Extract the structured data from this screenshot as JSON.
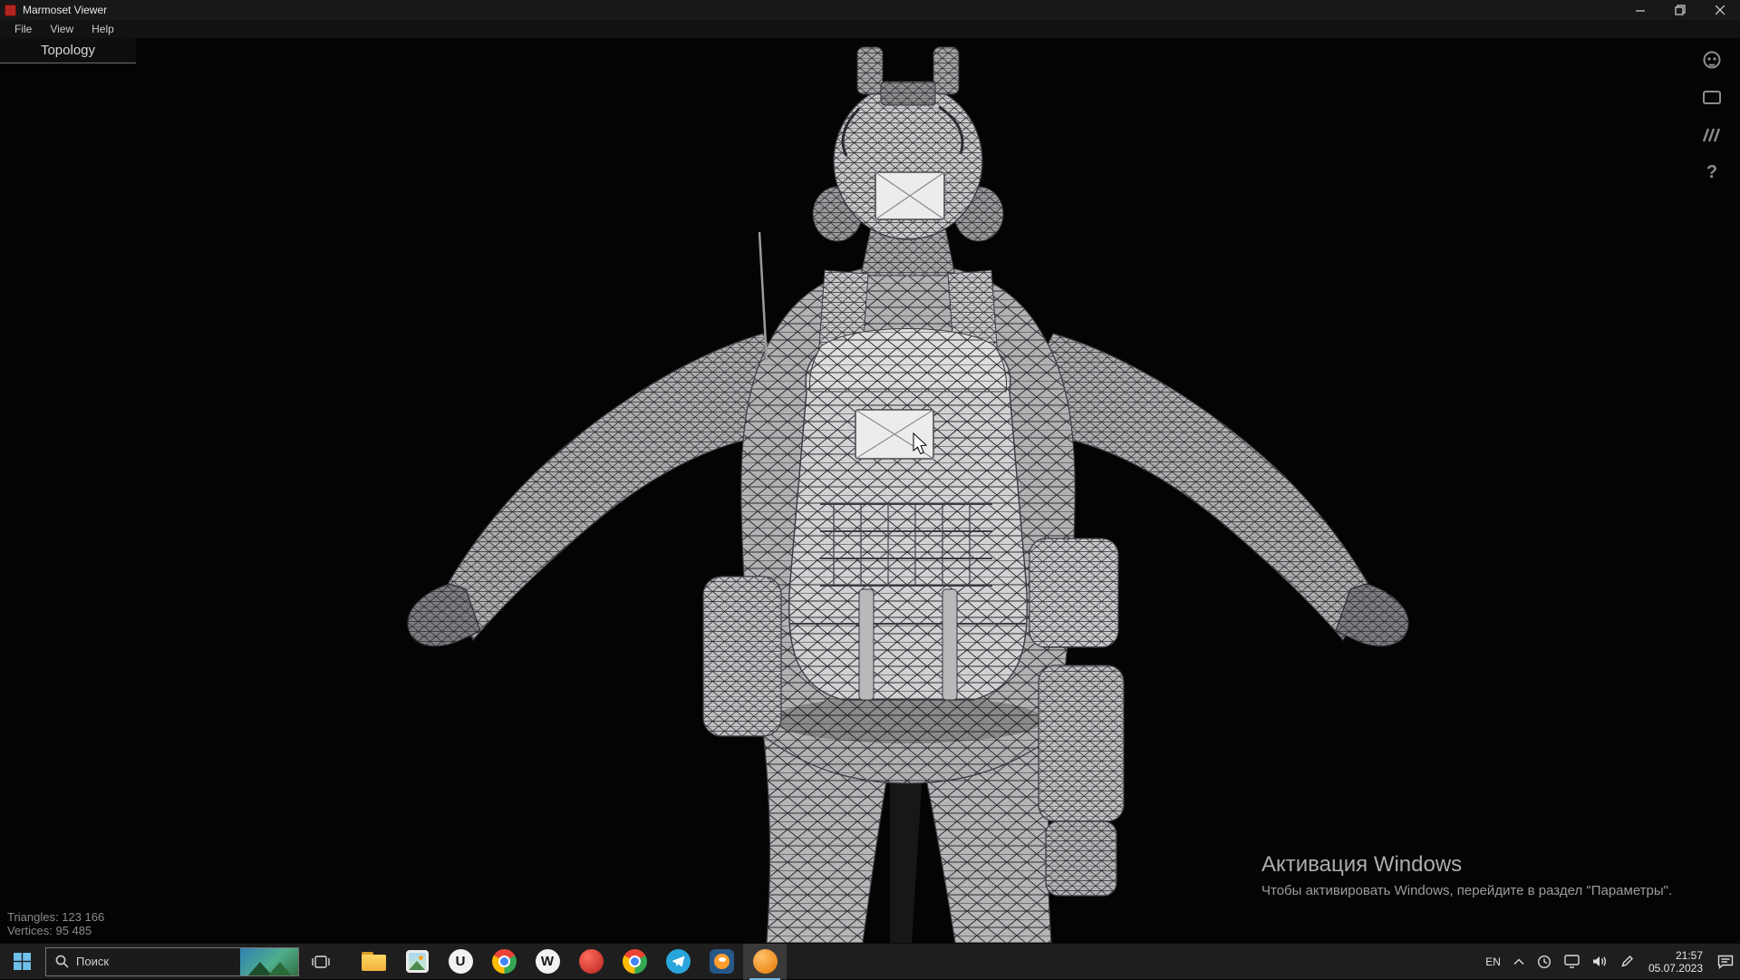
{
  "window": {
    "title": "Marmoset Viewer"
  },
  "menu": {
    "file": "File",
    "view": "View",
    "help": "Help"
  },
  "viewport": {
    "tab_label": "Topology",
    "stats": {
      "triangles": "Triangles: 123 166",
      "vertices": "Vertices: 95 485"
    },
    "activation": {
      "title": "Активация Windows",
      "subtitle": "Чтобы активировать Windows, перейдите в раздел \"Параметры\"."
    },
    "help_glyph": "?"
  },
  "model": {
    "description": "3D soldier character wireframe mesh, back view, T-pose, gray on black",
    "triangles": "123 166",
    "vertices": "95 485"
  },
  "taskbar": {
    "search_placeholder": "Поиск",
    "apps": [
      {
        "name": "file-explorer"
      },
      {
        "name": "photo-viewer"
      },
      {
        "name": "unreal-engine",
        "letter": "U"
      },
      {
        "name": "chrome"
      },
      {
        "name": "wattpad",
        "letter": "W"
      },
      {
        "name": "marmoset-toolbag"
      },
      {
        "name": "chrome-profile-2"
      },
      {
        "name": "telegram"
      },
      {
        "name": "blender"
      },
      {
        "name": "marmoset-viewer"
      }
    ],
    "tray": {
      "language": "EN",
      "time": "21:57",
      "date": "05.07.2023"
    }
  }
}
